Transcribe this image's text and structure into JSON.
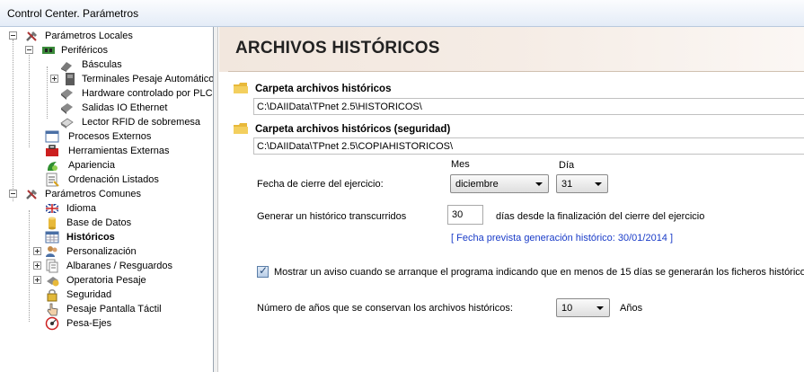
{
  "window": {
    "title": "Control Center. Parámetros"
  },
  "tree": {
    "local": {
      "label": "Parámetros Locales"
    },
    "perifericos": {
      "label": "Periféricos"
    },
    "basculas": {
      "label": "Básculas"
    },
    "terminales": {
      "label": "Terminales Pesaje Automático"
    },
    "hardware_plc": {
      "label": "Hardware controlado por PLC"
    },
    "salidas_io": {
      "label": "Salidas IO Ethernet"
    },
    "lector_rfid": {
      "label": "Lector RFID de sobremesa"
    },
    "procesos": {
      "label": "Procesos Externos"
    },
    "herramientas": {
      "label": "Herramientas Externas"
    },
    "apariencia": {
      "label": "Apariencia"
    },
    "ordenacion": {
      "label": "Ordenación Listados"
    },
    "comunes": {
      "label": "Parámetros Comunes"
    },
    "idioma": {
      "label": "Idioma"
    },
    "base_datos": {
      "label": "Base de Datos"
    },
    "historicos": {
      "label": "Históricos"
    },
    "personalizacion": {
      "label": "Personalización"
    },
    "albaranes": {
      "label": "Albaranes / Resguardos"
    },
    "operatoria": {
      "label": "Operatoria Pesaje"
    },
    "seguridad": {
      "label": "Seguridad"
    },
    "pesaje_tactil": {
      "label": "Pesaje Pantalla Táctil"
    },
    "pesa_ejes": {
      "label": "Pesa-Ejes"
    }
  },
  "main": {
    "heading": "ARCHIVOS HISTÓRICOS",
    "folder1": {
      "label": "Carpeta archivos históricos",
      "value": "C:\\DAIIData\\TPnet 2.5\\HISTORICOS\\"
    },
    "folder2": {
      "label": "Carpeta archivos históricos (seguridad)",
      "value": "C:\\DAIIData\\TPnet 2.5\\COPIAHISTORICOS\\"
    },
    "fecha": {
      "label": "Fecha de cierre del ejercicio:",
      "mes_header": "Mes",
      "dia_header": "Día",
      "mes_value": "diciembre",
      "dia_value": "31"
    },
    "generar": {
      "label": "Generar un histórico transcurridos",
      "days": "30",
      "suffix": "días desde la finalización del cierre del ejercicio",
      "prevista": "[ Fecha prevista generación histórico: 30/01/2014 ]"
    },
    "aviso": {
      "checked": true,
      "label": "Mostrar un aviso cuando se arranque el programa indicando que en menos de 15 días se generarán los ficheros históricos"
    },
    "anios": {
      "label": "Número de años que se conservan los archivos históricos:",
      "value": "10",
      "unit": "Años"
    }
  }
}
